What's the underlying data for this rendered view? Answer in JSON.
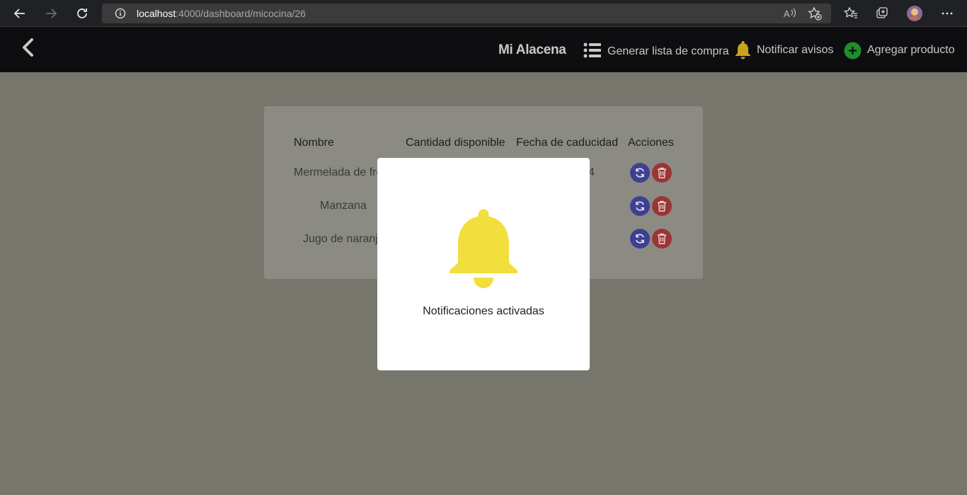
{
  "browser": {
    "url_host": "localhost",
    "url_path": ":4000/dashboard/micocina/26"
  },
  "header": {
    "title": "Mi Alacena",
    "actions": [
      {
        "label": "Generar lista de compra",
        "icon": "list-icon"
      },
      {
        "label": "Notificar avisos",
        "icon": "bell-icon"
      },
      {
        "label": "Agregar producto",
        "icon": "plus-circle-icon"
      }
    ]
  },
  "table": {
    "headers": [
      "Nombre",
      "Cantidad disponible",
      "Fecha de caducidad",
      "Acciones"
    ],
    "rows": [
      {
        "name": "Mermelada de fre",
        "expiry_fragment": "4"
      },
      {
        "name": "Manzana",
        "expiry_fragment": ""
      },
      {
        "name": "Jugo de naranj",
        "expiry_fragment": ""
      }
    ]
  },
  "modal": {
    "icon": "bell-icon",
    "message": "Notificaciones activadas"
  },
  "colors": {
    "bell_yellow": "#f2de3c",
    "header_bg": "#0e0e10",
    "overlay_bg": "#76766c",
    "plus_green": "#1f8f2c",
    "refresh_blue": "#3f3f93",
    "delete_red": "#9a3535"
  }
}
